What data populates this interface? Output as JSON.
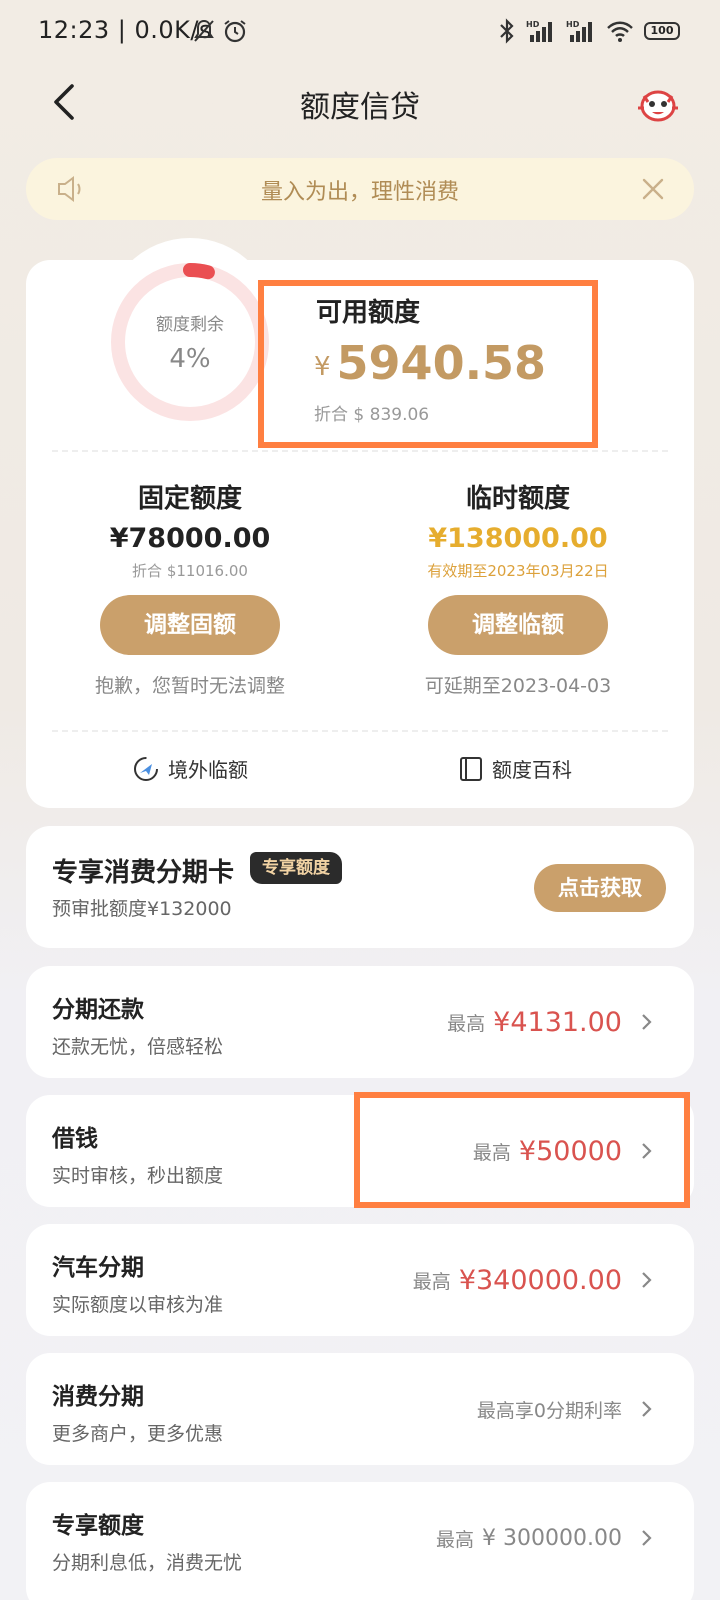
{
  "status": {
    "time_text": "12:23 | 0.0K/s",
    "battery": "100"
  },
  "nav": {
    "title": "额度信贷"
  },
  "notice": {
    "text": "量入为出，理性消费"
  },
  "summary": {
    "ring_label": "额度剩余",
    "ring_percent": "4%",
    "ring_fraction": 0.04,
    "available_title": "可用额度",
    "available_currency": "¥",
    "available_amount": "5940.58",
    "available_usd": "折合 $ 839.06",
    "fixed": {
      "title": "固定额度",
      "amount": "¥78000.00",
      "usd": "折合 $11016.00",
      "button": "调整固额",
      "note": "抱歉，您暂时无法调整"
    },
    "temp": {
      "title": "临时额度",
      "amount": "¥138000.00",
      "validity": "有效期至2023年03月22日",
      "button": "调整临额",
      "note": "可延期至2023-04-03"
    },
    "links": {
      "overseas": "境外临额",
      "wiki": "额度百科"
    }
  },
  "exclusive_card": {
    "title": "专享消费分期卡",
    "badge": "专享额度",
    "subtitle": "预审批额度¥132000",
    "button": "点击获取"
  },
  "list": [
    {
      "title": "分期还款",
      "subtitle": "还款无忧，倍感轻松",
      "prefix": "最高",
      "value": "¥4131.00"
    },
    {
      "title": "借钱",
      "subtitle": "实时审核，秒出额度",
      "prefix": "最高",
      "value": "¥50000"
    },
    {
      "title": "汽车分期",
      "subtitle": "实际额度以审核为准",
      "prefix": "最高",
      "value": "¥340000.00"
    },
    {
      "title": "消费分期",
      "subtitle": "更多商户，更多优惠",
      "prefix": "",
      "value": "最高享0分期利率"
    },
    {
      "title": "专享额度",
      "subtitle": "分期利息低，消费无忧",
      "prefix": "最高",
      "value": "¥ 300000.00"
    }
  ],
  "colors": {
    "accent": "#caa06b",
    "highlight": "#ff7f41",
    "red": "#d9534f",
    "gold": "#e6ad2e"
  }
}
